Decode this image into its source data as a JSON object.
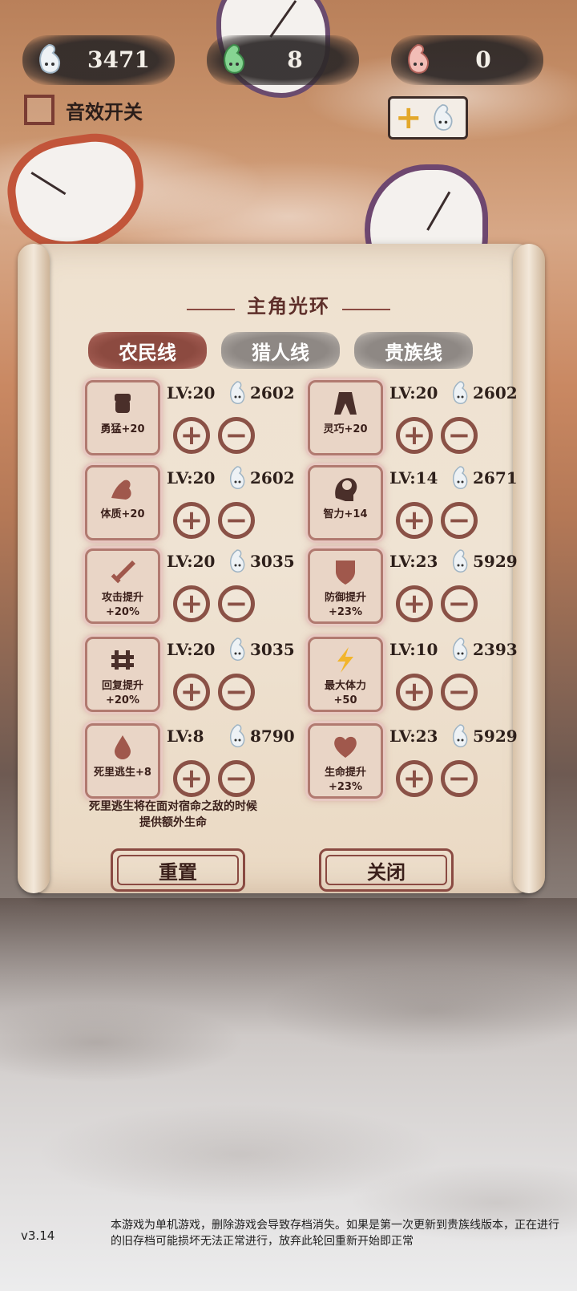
{
  "currencies": [
    {
      "value": "3471",
      "color": "#e8edf0"
    },
    {
      "value": "8",
      "color": "#7fd08a"
    },
    {
      "value": "0",
      "color": "#f0b3ad"
    }
  ],
  "sound_toggle_label": "音效开关",
  "panel_title": "主角光环",
  "tabs": [
    {
      "label": "农民线",
      "active": true
    },
    {
      "label": "猎人线",
      "active": false
    },
    {
      "label": "贵族线",
      "active": false
    }
  ],
  "skills": [
    {
      "name": "勇猛+20",
      "icon": "fist-icon",
      "level": "LV:20",
      "cost": "2602"
    },
    {
      "name": "灵巧+20",
      "icon": "cloak-icon",
      "level": "LV:20",
      "cost": "2602"
    },
    {
      "name": "体质+20",
      "icon": "arm-icon",
      "level": "LV:20",
      "cost": "2602"
    },
    {
      "name": "智力+14",
      "icon": "brain-icon",
      "level": "LV:14",
      "cost": "2671"
    },
    {
      "name": "攻击提升\n+20%",
      "icon": "sword-icon",
      "level": "LV:20",
      "cost": "3035"
    },
    {
      "name": "防御提升\n+23%",
      "icon": "shield-icon",
      "level": "LV:23",
      "cost": "5929"
    },
    {
      "name": "回复提升\n+20%",
      "icon": "cross-icon",
      "level": "LV:20",
      "cost": "3035"
    },
    {
      "name": "最大体力\n+50",
      "icon": "lightning-icon",
      "level": "LV:10",
      "cost": "2393"
    },
    {
      "name": "死里逃生+8",
      "icon": "drop-icon",
      "level": "LV:8",
      "cost": "8790"
    },
    {
      "name": "生命提升\n+23%",
      "icon": "heart-icon",
      "level": "LV:23",
      "cost": "5929"
    }
  ],
  "plus_symbol": "+",
  "minus_symbol": "−",
  "skill_description": "死里逃生将在面对宿命之敌的时候\n提供额外生命",
  "buttons": {
    "reset": "重置",
    "close": "关闭"
  },
  "add_currency_plus": "+",
  "version": "v3.14",
  "notice": "本游戏为单机游戏，删除游戏会导致存档消失。如果是第一次更新到贵族线版本，正在进行的旧存档可能损坏无法正常进行，放弃此轮回重新开始即正常"
}
